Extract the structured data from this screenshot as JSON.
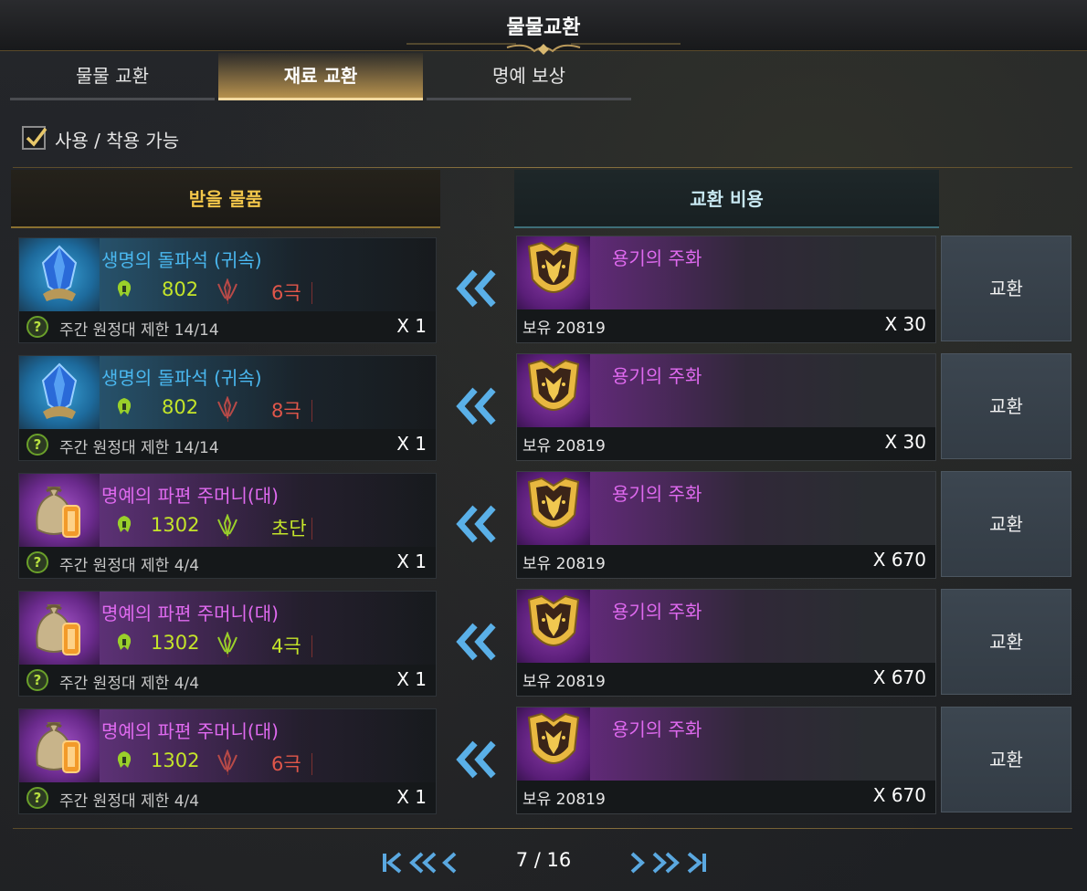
{
  "window": {
    "title": "물물교환"
  },
  "tabs": [
    {
      "label": "물물 교환",
      "active": false
    },
    {
      "label": "재료 교환",
      "active": true
    },
    {
      "label": "명예 보상",
      "active": false
    }
  ],
  "filter": {
    "label": "사용 / 착용 가능",
    "checked": true
  },
  "headers": {
    "receive": "받을 물품",
    "cost": "교환 비용"
  },
  "rows": [
    {
      "receive": {
        "name": "생명의 돌파석 (귀속)",
        "theme": "blue",
        "item_level": "802",
        "grade": "6극",
        "grade_color": "#e0564a",
        "limit": "주간 원정대 제한 14/14",
        "qty": "X 1"
      },
      "cost": {
        "name": "용기의 주화",
        "owned": "보유 20819",
        "qty": "X 30"
      },
      "button": "교환"
    },
    {
      "receive": {
        "name": "생명의 돌파석 (귀속)",
        "theme": "blue",
        "item_level": "802",
        "grade": "8극",
        "grade_color": "#e0564a",
        "limit": "주간 원정대 제한 14/14",
        "qty": "X 1"
      },
      "cost": {
        "name": "용기의 주화",
        "owned": "보유 20819",
        "qty": "X 30"
      },
      "button": "교환"
    },
    {
      "receive": {
        "name": "명예의 파편 주머니(대)",
        "theme": "purple",
        "item_level": "1302",
        "grade": "초단",
        "grade_color": "#c4e42a",
        "limit": "주간 원정대 제한 4/4",
        "qty": "X 1"
      },
      "cost": {
        "name": "용기의 주화",
        "owned": "보유 20819",
        "qty": "X 670"
      },
      "button": "교환"
    },
    {
      "receive": {
        "name": "명예의 파편 주머니(대)",
        "theme": "purple",
        "item_level": "1302",
        "grade": "4극",
        "grade_color": "#c4e42a",
        "limit": "주간 원정대 제한 4/4",
        "qty": "X 1"
      },
      "cost": {
        "name": "용기의 주화",
        "owned": "보유 20819",
        "qty": "X 670"
      },
      "button": "교환"
    },
    {
      "receive": {
        "name": "명예의 파편 주머니(대)",
        "theme": "purple",
        "item_level": "1302",
        "grade": "6극",
        "grade_color": "#e0564a",
        "limit": "주간 원정대 제한 4/4",
        "qty": "X 1"
      },
      "cost": {
        "name": "용기의 주화",
        "owned": "보유 20819",
        "qty": "X 670"
      },
      "button": "교환"
    }
  ],
  "pagination": {
    "text": "7 / 16"
  }
}
